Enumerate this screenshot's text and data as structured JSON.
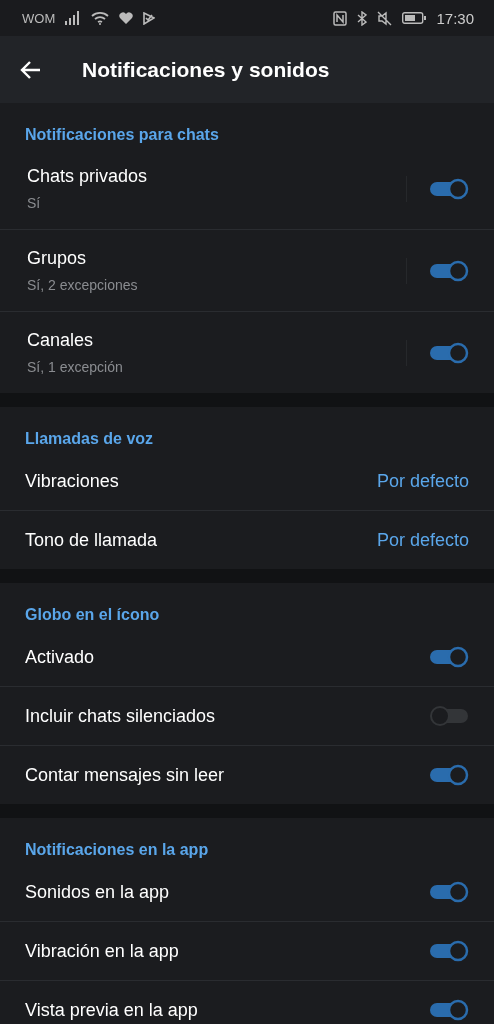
{
  "status_bar": {
    "carrier": "WOM",
    "time": "17:30"
  },
  "header": {
    "title": "Notificaciones y sonidos"
  },
  "sections": [
    {
      "title": "Notificaciones para chats",
      "rows": [
        {
          "kind": "switch",
          "label": "Chats privados",
          "subtitle": "Sí",
          "on": true
        },
        {
          "kind": "switch",
          "label": "Grupos",
          "subtitle": "Sí, 2 excepciones",
          "on": true
        },
        {
          "kind": "switch",
          "label": "Canales",
          "subtitle": "Sí, 1 excepción",
          "on": true
        }
      ]
    },
    {
      "title": "Llamadas de voz",
      "rows": [
        {
          "kind": "value",
          "label": "Vibraciones",
          "value": "Por defecto"
        },
        {
          "kind": "value",
          "label": "Tono de llamada",
          "value": "Por defecto"
        }
      ]
    },
    {
      "title": "Globo en el ícono",
      "rows": [
        {
          "kind": "switch",
          "label": "Activado",
          "on": true
        },
        {
          "kind": "switch",
          "label": "Incluir chats silenciados",
          "on": false
        },
        {
          "kind": "switch",
          "label": "Contar mensajes sin leer",
          "on": true
        }
      ]
    },
    {
      "title": "Notificaciones en la app",
      "rows": [
        {
          "kind": "switch",
          "label": "Sonidos en la app",
          "on": true
        },
        {
          "kind": "switch",
          "label": "Vibración en la app",
          "on": true
        },
        {
          "kind": "switch",
          "label": "Vista previa en la app",
          "on": true
        }
      ]
    }
  ]
}
